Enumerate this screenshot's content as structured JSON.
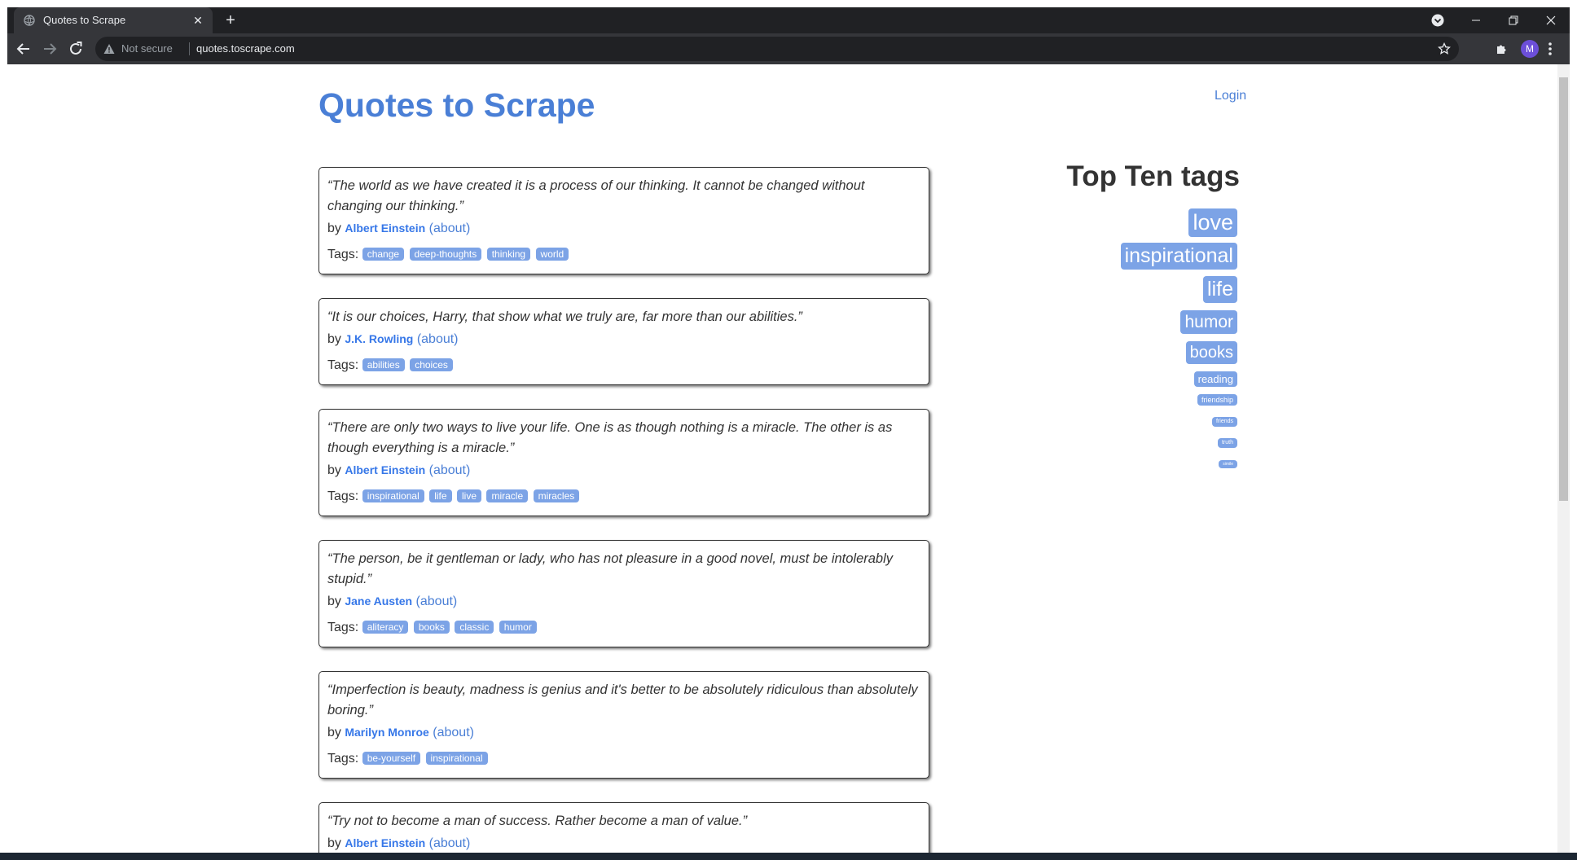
{
  "browser": {
    "tab_title": "Quotes to Scrape",
    "tab_close": "✕",
    "new_tab": "+",
    "security_label": "Not secure",
    "url": "quotes.toscrape.com",
    "profile_initial": "M"
  },
  "site": {
    "title": "Quotes to Scrape",
    "login_label": "Login"
  },
  "labels": {
    "by": "by",
    "about": "(about)",
    "tags": "Tags:"
  },
  "quotes": [
    {
      "text": "“The world as we have created it is a process of our thinking. It cannot be changed without changing our thinking.”",
      "author": "Albert Einstein",
      "tags": [
        "change",
        "deep-thoughts",
        "thinking",
        "world"
      ]
    },
    {
      "text": "“It is our choices, Harry, that show what we truly are, far more than our abilities.”",
      "author": "J.K. Rowling",
      "tags": [
        "abilities",
        "choices"
      ]
    },
    {
      "text": "“There are only two ways to live your life. One is as though nothing is a miracle. The other is as though everything is a miracle.”",
      "author": "Albert Einstein",
      "tags": [
        "inspirational",
        "life",
        "live",
        "miracle",
        "miracles"
      ]
    },
    {
      "text": "“The person, be it gentleman or lady, who has not pleasure in a good novel, must be intolerably stupid.”",
      "author": "Jane Austen",
      "tags": [
        "aliteracy",
        "books",
        "classic",
        "humor"
      ]
    },
    {
      "text": "“Imperfection is beauty, madness is genius and it's better to be absolutely ridiculous than absolutely boring.”",
      "author": "Marilyn Monroe",
      "tags": [
        "be-yourself",
        "inspirational"
      ]
    },
    {
      "text": "“Try not to become a man of success. Rather become a man of value.”",
      "author": "Albert Einstein",
      "tags": []
    }
  ],
  "top_tags": {
    "title": "Top Ten tags",
    "tags": [
      "love",
      "inspirational",
      "life",
      "humor",
      "books",
      "reading",
      "friendship",
      "friends",
      "truth",
      "simile"
    ]
  },
  "colors": {
    "accent": "#4a7fd6",
    "tag_bg": "#7ca3e6",
    "chrome_dark": "#202124",
    "chrome_toolbar": "#35363a"
  }
}
